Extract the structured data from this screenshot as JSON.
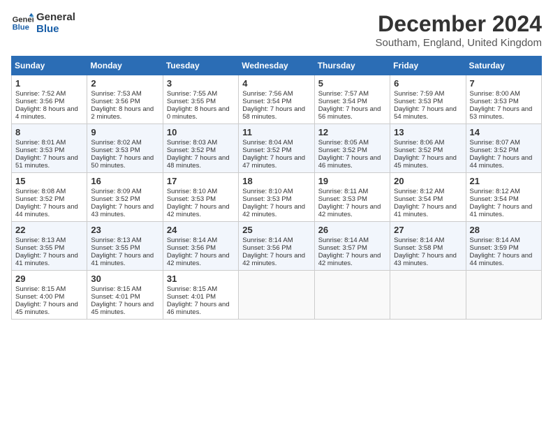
{
  "logo": {
    "line1": "General",
    "line2": "Blue"
  },
  "title": "December 2024",
  "subtitle": "Southam, England, United Kingdom",
  "headers": [
    "Sunday",
    "Monday",
    "Tuesday",
    "Wednesday",
    "Thursday",
    "Friday",
    "Saturday"
  ],
  "weeks": [
    [
      {
        "day": "1",
        "sunrise": "Sunrise: 7:52 AM",
        "sunset": "Sunset: 3:56 PM",
        "daylight": "Daylight: 8 hours and 4 minutes."
      },
      {
        "day": "2",
        "sunrise": "Sunrise: 7:53 AM",
        "sunset": "Sunset: 3:56 PM",
        "daylight": "Daylight: 8 hours and 2 minutes."
      },
      {
        "day": "3",
        "sunrise": "Sunrise: 7:55 AM",
        "sunset": "Sunset: 3:55 PM",
        "daylight": "Daylight: 8 hours and 0 minutes."
      },
      {
        "day": "4",
        "sunrise": "Sunrise: 7:56 AM",
        "sunset": "Sunset: 3:54 PM",
        "daylight": "Daylight: 7 hours and 58 minutes."
      },
      {
        "day": "5",
        "sunrise": "Sunrise: 7:57 AM",
        "sunset": "Sunset: 3:54 PM",
        "daylight": "Daylight: 7 hours and 56 minutes."
      },
      {
        "day": "6",
        "sunrise": "Sunrise: 7:59 AM",
        "sunset": "Sunset: 3:53 PM",
        "daylight": "Daylight: 7 hours and 54 minutes."
      },
      {
        "day": "7",
        "sunrise": "Sunrise: 8:00 AM",
        "sunset": "Sunset: 3:53 PM",
        "daylight": "Daylight: 7 hours and 53 minutes."
      }
    ],
    [
      {
        "day": "8",
        "sunrise": "Sunrise: 8:01 AM",
        "sunset": "Sunset: 3:53 PM",
        "daylight": "Daylight: 7 hours and 51 minutes."
      },
      {
        "day": "9",
        "sunrise": "Sunrise: 8:02 AM",
        "sunset": "Sunset: 3:53 PM",
        "daylight": "Daylight: 7 hours and 50 minutes."
      },
      {
        "day": "10",
        "sunrise": "Sunrise: 8:03 AM",
        "sunset": "Sunset: 3:52 PM",
        "daylight": "Daylight: 7 hours and 48 minutes."
      },
      {
        "day": "11",
        "sunrise": "Sunrise: 8:04 AM",
        "sunset": "Sunset: 3:52 PM",
        "daylight": "Daylight: 7 hours and 47 minutes."
      },
      {
        "day": "12",
        "sunrise": "Sunrise: 8:05 AM",
        "sunset": "Sunset: 3:52 PM",
        "daylight": "Daylight: 7 hours and 46 minutes."
      },
      {
        "day": "13",
        "sunrise": "Sunrise: 8:06 AM",
        "sunset": "Sunset: 3:52 PM",
        "daylight": "Daylight: 7 hours and 45 minutes."
      },
      {
        "day": "14",
        "sunrise": "Sunrise: 8:07 AM",
        "sunset": "Sunset: 3:52 PM",
        "daylight": "Daylight: 7 hours and 44 minutes."
      }
    ],
    [
      {
        "day": "15",
        "sunrise": "Sunrise: 8:08 AM",
        "sunset": "Sunset: 3:52 PM",
        "daylight": "Daylight: 7 hours and 44 minutes."
      },
      {
        "day": "16",
        "sunrise": "Sunrise: 8:09 AM",
        "sunset": "Sunset: 3:52 PM",
        "daylight": "Daylight: 7 hours and 43 minutes."
      },
      {
        "day": "17",
        "sunrise": "Sunrise: 8:10 AM",
        "sunset": "Sunset: 3:53 PM",
        "daylight": "Daylight: 7 hours and 42 minutes."
      },
      {
        "day": "18",
        "sunrise": "Sunrise: 8:10 AM",
        "sunset": "Sunset: 3:53 PM",
        "daylight": "Daylight: 7 hours and 42 minutes."
      },
      {
        "day": "19",
        "sunrise": "Sunrise: 8:11 AM",
        "sunset": "Sunset: 3:53 PM",
        "daylight": "Daylight: 7 hours and 42 minutes."
      },
      {
        "day": "20",
        "sunrise": "Sunrise: 8:12 AM",
        "sunset": "Sunset: 3:54 PM",
        "daylight": "Daylight: 7 hours and 41 minutes."
      },
      {
        "day": "21",
        "sunrise": "Sunrise: 8:12 AM",
        "sunset": "Sunset: 3:54 PM",
        "daylight": "Daylight: 7 hours and 41 minutes."
      }
    ],
    [
      {
        "day": "22",
        "sunrise": "Sunrise: 8:13 AM",
        "sunset": "Sunset: 3:55 PM",
        "daylight": "Daylight: 7 hours and 41 minutes."
      },
      {
        "day": "23",
        "sunrise": "Sunrise: 8:13 AM",
        "sunset": "Sunset: 3:55 PM",
        "daylight": "Daylight: 7 hours and 41 minutes."
      },
      {
        "day": "24",
        "sunrise": "Sunrise: 8:14 AM",
        "sunset": "Sunset: 3:56 PM",
        "daylight": "Daylight: 7 hours and 42 minutes."
      },
      {
        "day": "25",
        "sunrise": "Sunrise: 8:14 AM",
        "sunset": "Sunset: 3:56 PM",
        "daylight": "Daylight: 7 hours and 42 minutes."
      },
      {
        "day": "26",
        "sunrise": "Sunrise: 8:14 AM",
        "sunset": "Sunset: 3:57 PM",
        "daylight": "Daylight: 7 hours and 42 minutes."
      },
      {
        "day": "27",
        "sunrise": "Sunrise: 8:14 AM",
        "sunset": "Sunset: 3:58 PM",
        "daylight": "Daylight: 7 hours and 43 minutes."
      },
      {
        "day": "28",
        "sunrise": "Sunrise: 8:14 AM",
        "sunset": "Sunset: 3:59 PM",
        "daylight": "Daylight: 7 hours and 44 minutes."
      }
    ],
    [
      {
        "day": "29",
        "sunrise": "Sunrise: 8:15 AM",
        "sunset": "Sunset: 4:00 PM",
        "daylight": "Daylight: 7 hours and 45 minutes."
      },
      {
        "day": "30",
        "sunrise": "Sunrise: 8:15 AM",
        "sunset": "Sunset: 4:01 PM",
        "daylight": "Daylight: 7 hours and 45 minutes."
      },
      {
        "day": "31",
        "sunrise": "Sunrise: 8:15 AM",
        "sunset": "Sunset: 4:01 PM",
        "daylight": "Daylight: 7 hours and 46 minutes."
      },
      null,
      null,
      null,
      null
    ]
  ]
}
